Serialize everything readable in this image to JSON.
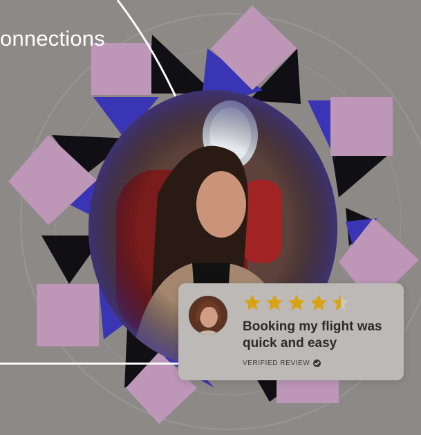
{
  "hero": {
    "headline": "onnections"
  },
  "review": {
    "quote": "Booking my flight was quick and easy",
    "verified_label": "VERIFIED REVIEW",
    "rating": 4.5,
    "max_rating": 5
  },
  "colors": {
    "background": "#8d8986",
    "pink": "#bd96b8",
    "blue": "#3a35b4",
    "dark": "#0e0e12",
    "star": "#d7a312",
    "card": "#bdb9b7",
    "text": "#2c2b2b"
  },
  "icons": {
    "verified": "check-badge-icon",
    "star": "star-icon"
  }
}
